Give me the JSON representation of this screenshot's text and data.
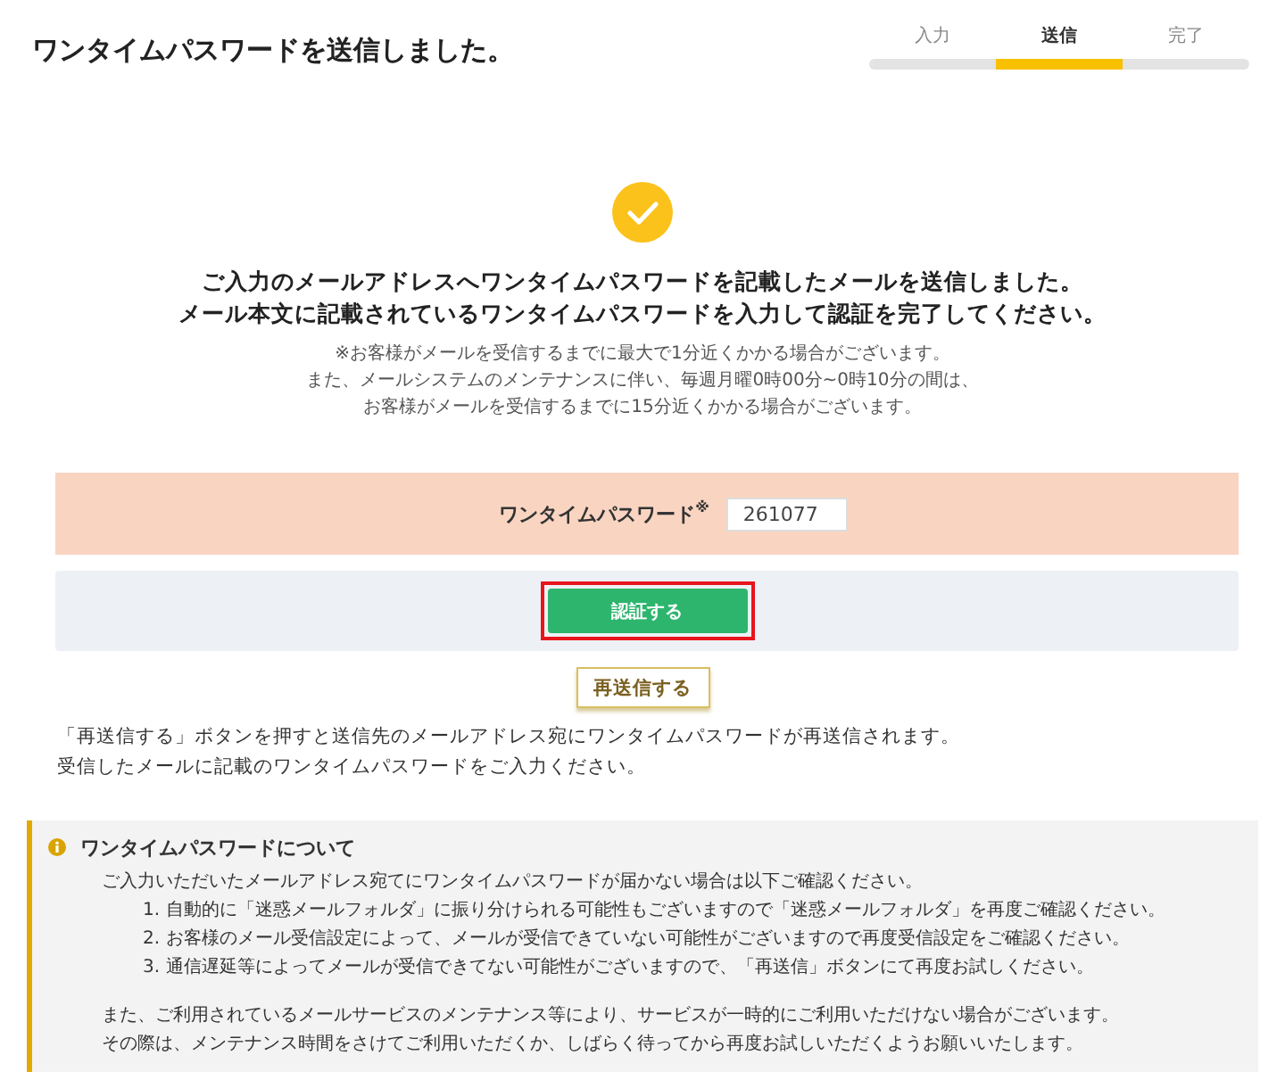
{
  "header": {
    "title": "ワンタイムパスワードを送信しました。",
    "steps": [
      {
        "label": "入力",
        "selected": false
      },
      {
        "label": "送信",
        "selected": true
      },
      {
        "label": "完了",
        "selected": false
      }
    ]
  },
  "confirmation": {
    "message": [
      "ご入力のメールアドレスへワンタイムパスワードを記載したメールを送信しました。",
      "メール本文に記載されているワンタイムパスワードを入力して認証を完了してください。"
    ],
    "notes": [
      "※お客様がメールを受信するまでに最大で1分近くかかる場合がございます。",
      "また、メールシステムのメンテナンスに伴い、毎週月曜0時00分~0時10分の間は、",
      "お客様がメールを受信するまでに15分近くかかる場合がございます。"
    ]
  },
  "form": {
    "label": "ワンタイムパスワード$^{※}$",
    "value": "261077"
  },
  "verify_button": {
    "label": "認証する",
    "highlighted": true
  },
  "resend_button": {
    "label": "再送信する"
  },
  "resend_notes": [
    "「再送信する」ボタンを押すと送信先のメールアドレス宛にワンタイムパスワードが再送信されます。",
    "受信したメールに記載のワンタイムパスワードをご入力ください。"
  ],
  "info": {
    "title": "ワンタイムパスワードについて",
    "intro": "ご入力いただいたメールアドレス宛てにワンタイムパスワードが届かない場合は以下ご確認ください。",
    "items": [
      {
        "number": "1.",
        "text": "自動的に「迷惑メールフォルダ」に振り分けられる可能性もございますので「迷惑メールフォルダ」を再度ご確認ください。"
      },
      {
        "number": "2.",
        "text": "お客様のメール受信設定によって、メールが受信できていない可能性がございますので再度受信設定をご確認ください。"
      },
      {
        "number": "3.",
        "text": "通信遅延等によってメールが受信できてない可能性がございますので、「再送信」ボタンにて再度お試しください。"
      }
    ],
    "outro": [
      "また、ご利用されているメールサービスのメンテナンス等により、サービスが一時的にご利用いただけない場合がございます。",
      "その際は、メンテナンス時間をさけてご利用いただくか、しばらく待ってから再度お試しいただくようお願いいたします。"
    ]
  }
}
